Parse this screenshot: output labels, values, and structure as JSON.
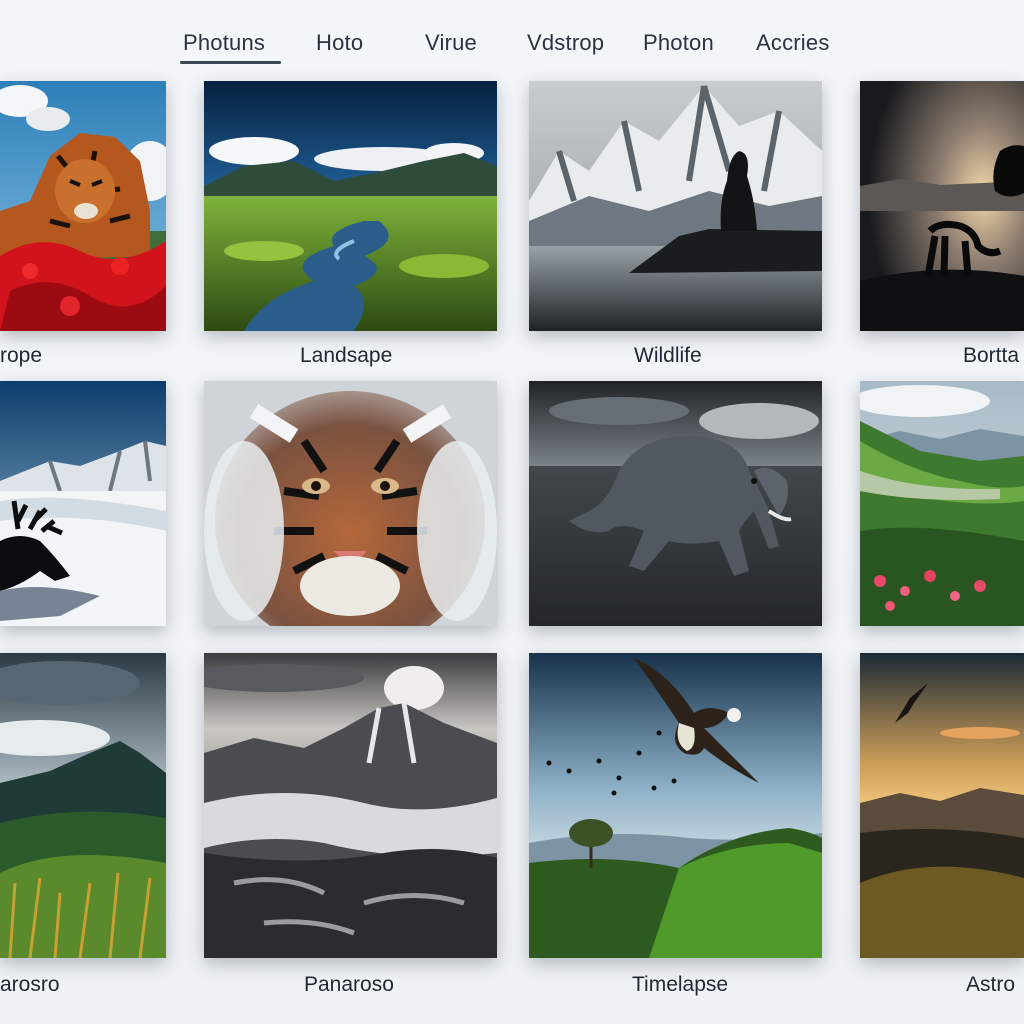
{
  "nav": {
    "tabs": [
      {
        "label": "Photuns",
        "active": true
      },
      {
        "label": "Hoto",
        "active": false
      },
      {
        "label": "Virue",
        "active": false
      },
      {
        "label": "Vdstrop",
        "active": false
      },
      {
        "label": "Photon",
        "active": false
      },
      {
        "label": "Accries",
        "active": false
      }
    ]
  },
  "gallery": {
    "rows": [
      [
        {
          "label": "rope",
          "subject": "tiger-in-red-flowers"
        },
        {
          "label": "Landsape",
          "subject": "green-valley-stream"
        },
        {
          "label": "Wildlife",
          "subject": "snowy-peaks-silhouette"
        },
        {
          "label": "Bortta",
          "subject": "panther-silhouette-dusk"
        }
      ],
      [
        {
          "label": "",
          "subject": "moose-on-snow"
        },
        {
          "label": "",
          "subject": "snowy-tiger-face"
        },
        {
          "label": "",
          "subject": "elephant-in-water"
        },
        {
          "label": "",
          "subject": "green-valley-flowers"
        }
      ],
      [
        {
          "label": "arosro",
          "subject": "mountain-meadow-clouds"
        },
        {
          "label": "Panaroso",
          "subject": "volcanic-mountains"
        },
        {
          "label": "Timelapse",
          "subject": "eagle-over-forest"
        },
        {
          "label": "Astro",
          "subject": "bird-at-sunset"
        }
      ]
    ]
  },
  "colors": {
    "accent": "#3b4654",
    "text": "#1f2833",
    "background": "#f1f4f7"
  }
}
